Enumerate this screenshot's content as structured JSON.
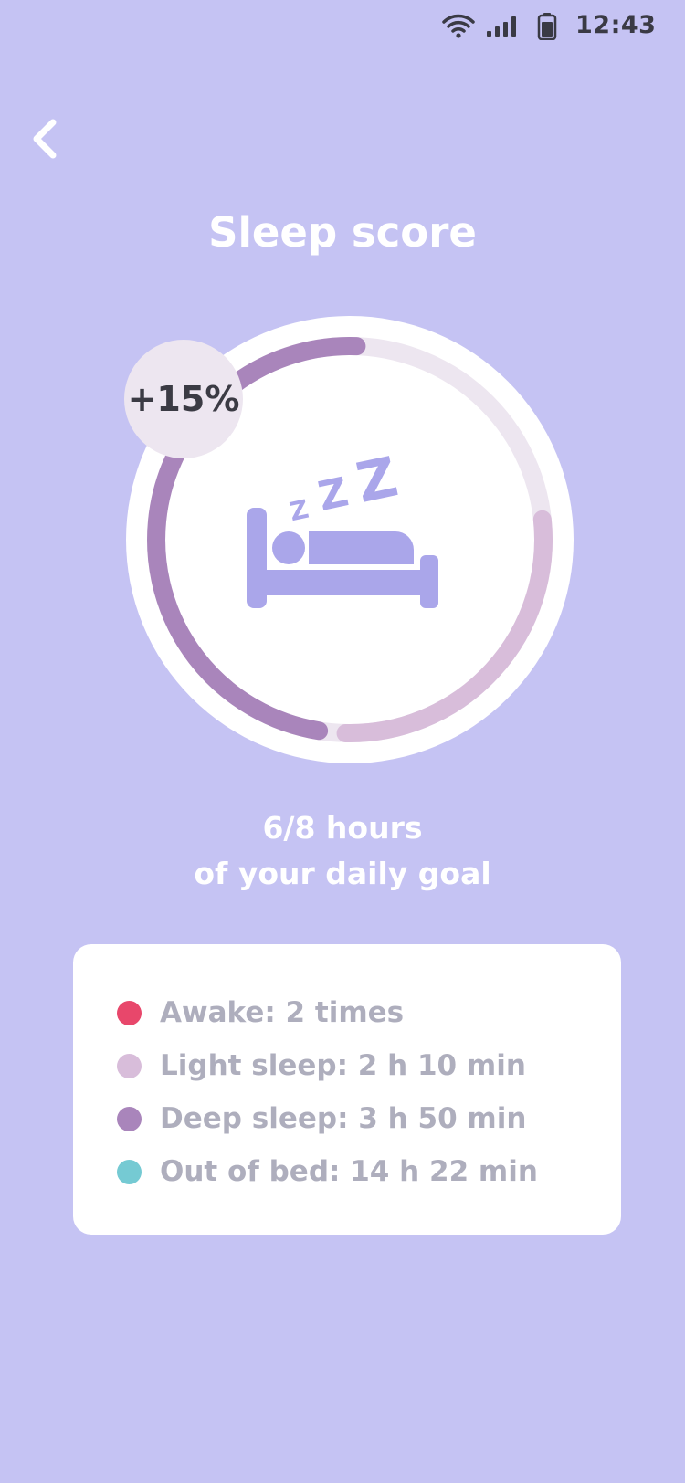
{
  "status_bar": {
    "time": "12:43",
    "icons": [
      "wifi-icon",
      "signal-icon",
      "battery-icon"
    ]
  },
  "header": {
    "back_icon": "chevron-left-icon",
    "title": "Sleep score"
  },
  "score": {
    "badge": "+15%",
    "icon": "sleeping-bed-icon",
    "hours_text": "6/8 hours",
    "goal_text": "of your daily goal",
    "deep_fraction": 0.48,
    "light_fraction": 0.27
  },
  "legend": [
    {
      "label": "Awake: 2 times",
      "color": "#e8476b"
    },
    {
      "label": "Light sleep: 2 h 10 min",
      "color": "#d8bdda"
    },
    {
      "label": "Deep sleep: 3 h 50 min",
      "color": "#a985bb"
    },
    {
      "label": "Out of bed: 14 h 22 min",
      "color": "#75cad3"
    }
  ],
  "colors": {
    "background": "#c5c3f3",
    "ring_track": "#ede6f0",
    "deep": "#a985bb",
    "light": "#d8bdda",
    "icon": "#aaa6ea"
  }
}
